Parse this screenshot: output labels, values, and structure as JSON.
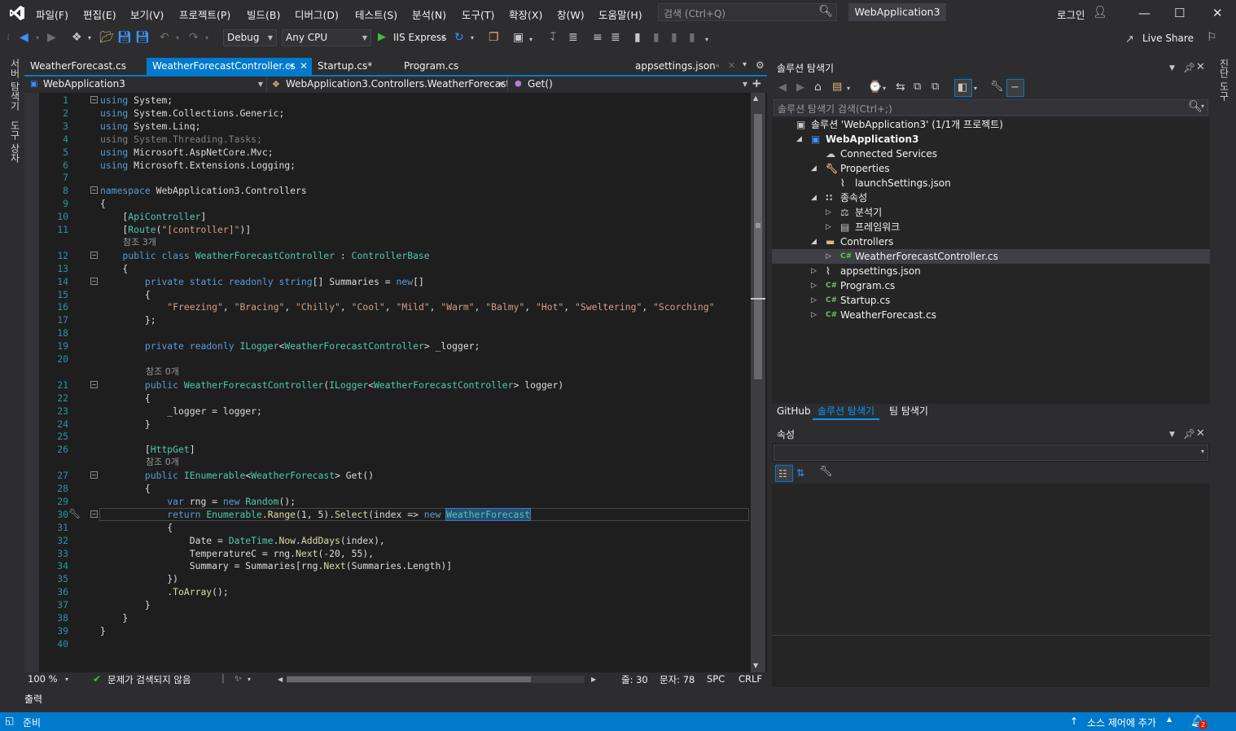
{
  "titlebar": {
    "menu": [
      "파일(F)",
      "편집(E)",
      "보기(V)",
      "프로젝트(P)",
      "빌드(B)",
      "디버그(D)",
      "테스트(S)",
      "분석(N)",
      "도구(T)",
      "확장(X)",
      "창(W)",
      "도움말(H)"
    ],
    "search_placeholder": "검색 (Ctrl+Q)",
    "app_title": "WebApplication3",
    "login": "로그인"
  },
  "toolbar": {
    "config": "Debug",
    "platform": "Any CPU",
    "run_target": "IIS Express",
    "live_share": "Live Share"
  },
  "left_tabs": [
    "서버 탐색기",
    "도구 상자"
  ],
  "right_tabs": [
    "진단 도구"
  ],
  "doc_tabs": [
    {
      "label": "WeatherForecast.cs",
      "active": false
    },
    {
      "label": "WeatherForecastController.cs",
      "active": true
    },
    {
      "label": "Startup.cs*",
      "active": false
    },
    {
      "label": "Program.cs",
      "active": false
    },
    {
      "label": "appsettings.json",
      "active": false
    }
  ],
  "navbar": {
    "project": "WebApplication3",
    "class": "WebApplication3.Controllers.WeatherForecastCo",
    "member": "Get()"
  },
  "code_lines": [
    "using System;",
    "using System.Collections.Generic;",
    "using System.Linq;",
    "using System.Threading.Tasks;",
    "using Microsoft.AspNetCore.Mvc;",
    "using Microsoft.Extensions.Logging;",
    "",
    "namespace WebApplication3.Controllers",
    "{",
    "    [ApiController]",
    "    [Route(\"[controller]\")]",
    "    public class WeatherForecastController : ControllerBase",
    "    {",
    "        private static readonly string[] Summaries = new[]",
    "        {",
    "            \"Freezing\", \"Bracing\", \"Chilly\", \"Cool\", \"Mild\", \"Warm\", \"Balmy\", \"Hot\", \"Sweltering\", \"Scorching\"",
    "        };",
    "",
    "        private readonly ILogger<WeatherForecastController> _logger;",
    "",
    "        public WeatherForecastController(ILogger<WeatherForecastController> logger)",
    "        {",
    "            _logger = logger;",
    "        }",
    "",
    "        [HttpGet]",
    "        public IEnumerable<WeatherForecast> Get()",
    "        {",
    "            var rng = new Random();",
    "            return Enumerable.Range(1, 5).Select(index => new WeatherForecast",
    "            {",
    "                Date = DateTime.Now.AddDays(index),",
    "                TemperatureC = rng.Next(-20, 55),",
    "                Summary = Summaries[rng.Next(Summaries.Length)]",
    "            })",
    "            .ToArray();",
    "        }",
    "    }",
    "}",
    ""
  ],
  "references": {
    "class": "참조 3개",
    "ctor": "참조 0개",
    "get": "참조 0개"
  },
  "editor_status": {
    "zoom": "100 %",
    "issues": "문제가 검색되지 않음",
    "line": "줄: 30",
    "col": "문자: 78",
    "spc": "SPC",
    "crlf": "CRLF"
  },
  "output_label": "출력",
  "solution_explorer": {
    "title": "솔루션 탐색기",
    "search_placeholder": "솔루션 탐색기 검색(Ctrl+;)",
    "items": [
      {
        "label": "솔루션 'WebApplication3' (1/1개 프로젝트)",
        "depth": 0,
        "icon": "solution-icon",
        "expander": "none"
      },
      {
        "label": "WebApplication3",
        "depth": 1,
        "icon": "project-icon",
        "expander": "open",
        "bold": true
      },
      {
        "label": "Connected Services",
        "depth": 2,
        "icon": "connected-services-icon",
        "expander": "none"
      },
      {
        "label": "Properties",
        "depth": 2,
        "icon": "properties-icon",
        "expander": "open"
      },
      {
        "label": "launchSettings.json",
        "depth": 3,
        "icon": "json-file-icon",
        "expander": "none"
      },
      {
        "label": "종속성",
        "depth": 2,
        "icon": "dependencies-icon",
        "expander": "open"
      },
      {
        "label": "분석기",
        "depth": 3,
        "icon": "analyzer-icon",
        "expander": "closed"
      },
      {
        "label": "프레임워크",
        "depth": 3,
        "icon": "framework-icon",
        "expander": "closed"
      },
      {
        "label": "Controllers",
        "depth": 2,
        "icon": "folder-icon",
        "expander": "open"
      },
      {
        "label": "WeatherForecastController.cs",
        "depth": 3,
        "icon": "csharp-file-icon",
        "expander": "closed",
        "selected": true
      },
      {
        "label": "appsettings.json",
        "depth": 2,
        "icon": "json-file-icon",
        "expander": "closed"
      },
      {
        "label": "Program.cs",
        "depth": 2,
        "icon": "csharp-file-icon",
        "expander": "closed"
      },
      {
        "label": "Startup.cs",
        "depth": 2,
        "icon": "csharp-file-icon",
        "expander": "closed"
      },
      {
        "label": "WeatherForecast.cs",
        "depth": 2,
        "icon": "csharp-file-icon",
        "expander": "closed"
      }
    ]
  },
  "bottom_tabs": [
    {
      "label": "GitHub",
      "active": false
    },
    {
      "label": "솔루션 탐색기",
      "active": true
    },
    {
      "label": "팀 탐색기",
      "active": false
    }
  ],
  "properties": {
    "title": "속성"
  },
  "statusbar": {
    "ready": "준비",
    "source_control": "소스 제어에 추가",
    "notification_count": "2"
  },
  "colors": {
    "accent": "#007acc",
    "background": "#1e1e1e",
    "keyword": "#569cd6",
    "type": "#4ec9b0",
    "string": "#d69d85",
    "line_number": "#2b91af"
  }
}
